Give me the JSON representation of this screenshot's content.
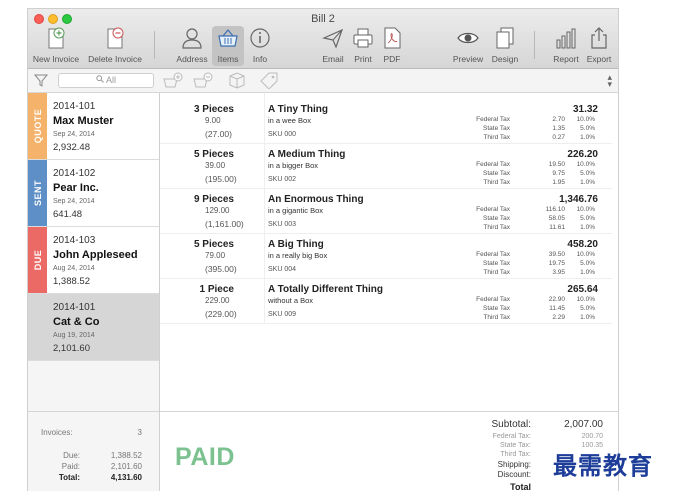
{
  "window": {
    "title": "Bill 2"
  },
  "toolbar": {
    "new_invoice": "New Invoice",
    "delete_invoice": "Delete Invoice",
    "address": "Address",
    "items": "Items",
    "info": "Info",
    "email": "Email",
    "print": "Print",
    "pdf": "PDF",
    "preview": "Preview",
    "design": "Design",
    "report": "Report",
    "export": "Export"
  },
  "filter": {
    "search_placeholder": "All"
  },
  "sidebar": {
    "invoices": [
      {
        "status": "QUOTE",
        "status_color": "#f5b26b",
        "number": "2014-101",
        "customer": "Max Muster",
        "date": "Sep 24, 2014",
        "amount": "2,932.48"
      },
      {
        "status": "SENT",
        "status_color": "#5e8fc6",
        "number": "2014-102",
        "customer": "Pear Inc.",
        "date": "Sep 24, 2014",
        "amount": "641.48"
      },
      {
        "status": "DUE",
        "status_color": "#ec6a66",
        "number": "2014-103",
        "customer": "John Appleseed",
        "date": "Aug 24, 2014",
        "amount": "1,388.52"
      },
      {
        "status": "",
        "status_color": "",
        "number": "2014-101",
        "customer": "Cat & Co",
        "date": "Aug 19, 2014",
        "amount": "2,101.60"
      }
    ],
    "summary": {
      "invoices_label": "Invoices:",
      "invoices_value": "3",
      "due_label": "Due:",
      "due_value": "1,388.52",
      "paid_label": "Paid:",
      "paid_value": "2,101.60",
      "total_label": "Total:",
      "total_value": "4,131.60"
    }
  },
  "items": [
    {
      "qty": "3 Pieces",
      "unit_price": "9.00",
      "line_total": "(27.00)",
      "title": "A Tiny Thing",
      "description": "in a wee Box",
      "sku": "SKU 000",
      "price": "31.32",
      "taxes": [
        {
          "name": "Federal Tax",
          "value": "2.70",
          "pct": "10.0%"
        },
        {
          "name": "State Tax",
          "value": "1.35",
          "pct": "5.0%"
        },
        {
          "name": "Third Tax",
          "value": "0.27",
          "pct": "1.0%"
        }
      ]
    },
    {
      "qty": "5 Pieces",
      "unit_price": "39.00",
      "line_total": "(195.00)",
      "title": "A Medium Thing",
      "description": "in a bigger Box",
      "sku": "SKU 002",
      "price": "226.20",
      "taxes": [
        {
          "name": "Federal Tax",
          "value": "19.50",
          "pct": "10.0%"
        },
        {
          "name": "State Tax",
          "value": "9.75",
          "pct": "5.0%"
        },
        {
          "name": "Third Tax",
          "value": "1.95",
          "pct": "1.0%"
        }
      ]
    },
    {
      "qty": "9 Pieces",
      "unit_price": "129.00",
      "line_total": "(1,161.00)",
      "title": "An Enormous Thing",
      "description": "in a gigantic Box",
      "sku": "SKU 003",
      "price": "1,346.76",
      "taxes": [
        {
          "name": "Federal Tax",
          "value": "116.10",
          "pct": "10.0%"
        },
        {
          "name": "State Tax",
          "value": "58.05",
          "pct": "5.0%"
        },
        {
          "name": "Third Tax",
          "value": "11.61",
          "pct": "1.0%"
        }
      ]
    },
    {
      "qty": "5 Pieces",
      "unit_price": "79.00",
      "line_total": "(395.00)",
      "title": "A Big Thing",
      "description": "in a really big Box",
      "sku": "SKU 004",
      "price": "458.20",
      "taxes": [
        {
          "name": "Federal Tax",
          "value": "39.50",
          "pct": "10.0%"
        },
        {
          "name": "State Tax",
          "value": "19.75",
          "pct": "5.0%"
        },
        {
          "name": "Third Tax",
          "value": "3.95",
          "pct": "1.0%"
        }
      ]
    },
    {
      "qty": "1 Piece",
      "unit_price": "229.00",
      "line_total": "(229.00)",
      "title": "A Totally Different Thing",
      "description": "without a Box",
      "sku": "SKU 009",
      "price": "265.64",
      "taxes": [
        {
          "name": "Federal Tax",
          "value": "22.90",
          "pct": "10.0%"
        },
        {
          "name": "State Tax",
          "value": "11.45",
          "pct": "5.0%"
        },
        {
          "name": "Third Tax",
          "value": "2.29",
          "pct": "1.0%"
        }
      ]
    }
  ],
  "footer": {
    "paid_stamp": "PAID",
    "subtotal_label": "Subtotal:",
    "subtotal_value": "2,007.00",
    "federal_label": "Federal Tax:",
    "federal_value": "200.70",
    "state_label": "State Tax:",
    "state_value": "100.35",
    "third_label": "Third Tax:",
    "third_value": "",
    "shipping_label": "Shipping:",
    "shipping_value": "",
    "discount_label": "Discount:",
    "discount_value": "",
    "total_label": "Total"
  },
  "watermark": "最需教育",
  "icons": {
    "new_invoice": "document-plus-icon",
    "delete_invoice": "document-minus-icon",
    "address": "person-icon",
    "items": "basket-icon",
    "info": "info-icon",
    "email": "paper-plane-icon",
    "print": "printer-icon",
    "pdf": "pdf-document-icon",
    "preview": "eye-icon",
    "design": "pages-stack-icon",
    "report": "bar-chart-icon",
    "export": "share-icon",
    "filter": "funnel-icon",
    "sort": "sort-arrows-icon"
  }
}
